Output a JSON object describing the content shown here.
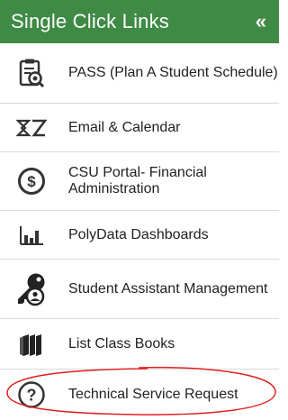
{
  "header": {
    "title": "Single Click Links",
    "collapse_label": "«"
  },
  "items": [
    {
      "label": "PASS (Plan A Student Schedule)",
      "icon": "clipboard-search-icon"
    },
    {
      "label": "Email & Calendar",
      "icon": "exchange-icon"
    },
    {
      "label": "CSU Portal- Financial Administration",
      "icon": "dollar-circle-icon"
    },
    {
      "label": "PolyData Dashboards",
      "icon": "bar-chart-icon"
    },
    {
      "label": "Student Assistant Management",
      "icon": "key-user-icon"
    },
    {
      "label": "List Class Books",
      "icon": "books-icon"
    },
    {
      "label": "Technical Service Request",
      "icon": "question-circle-icon"
    }
  ],
  "colors": {
    "header_bg": "#3f8a45",
    "header_text": "#ffffff",
    "annotation_circle": "#e02020"
  }
}
